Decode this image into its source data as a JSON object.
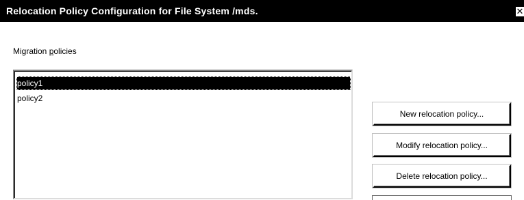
{
  "window": {
    "title": "Relocation Policy Configuration for File System /mds.",
    "close_glyph": "✕"
  },
  "migration": {
    "label_prefix": "Migration ",
    "label_accel": "p",
    "label_suffix": "olicies",
    "items": [
      {
        "label": "policy1",
        "selected": true
      },
      {
        "label": "policy2",
        "selected": false
      }
    ]
  },
  "buttons": {
    "new_label": "New relocation policy...",
    "modify_label": "Modify relocation policy...",
    "delete_label": "Delete relocation policy..."
  },
  "colors": {
    "titlebar": "#000000",
    "selection": "#000000",
    "background": "#ffffff"
  },
  "icons": {
    "close": "close-icon"
  }
}
